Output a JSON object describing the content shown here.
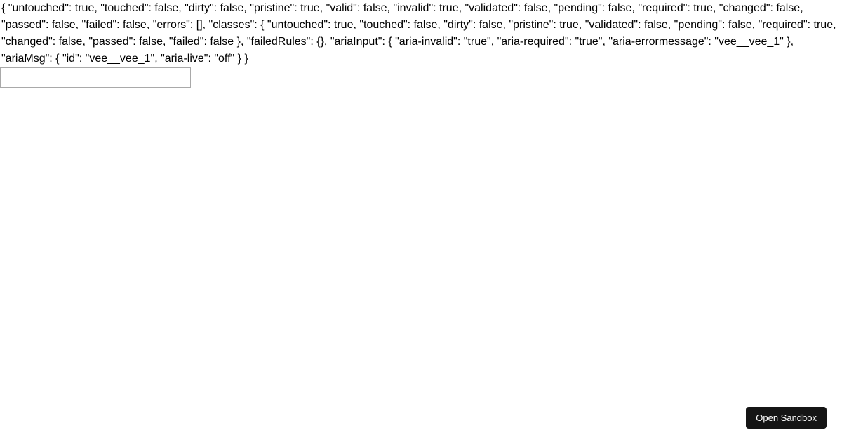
{
  "validation_state_text": "{ \"untouched\": true, \"touched\": false, \"dirty\": false, \"pristine\": true, \"valid\": false, \"invalid\": true, \"validated\": false, \"pending\": false, \"required\": true, \"changed\": false, \"passed\": false, \"failed\": false, \"errors\": [], \"classes\": { \"untouched\": true, \"touched\": false, \"dirty\": false, \"pristine\": true, \"validated\": false, \"pending\": false, \"required\": true, \"changed\": false, \"passed\": false, \"failed\": false }, \"failedRules\": {}, \"ariaInput\": { \"aria-invalid\": \"true\", \"aria-required\": \"true\", \"aria-errormessage\": \"vee__vee_1\" }, \"ariaMsg\": { \"id\": \"vee__vee_1\", \"aria-live\": \"off\" } }",
  "input": {
    "value": ""
  },
  "footer": {
    "open_sandbox_label": "Open Sandbox"
  }
}
